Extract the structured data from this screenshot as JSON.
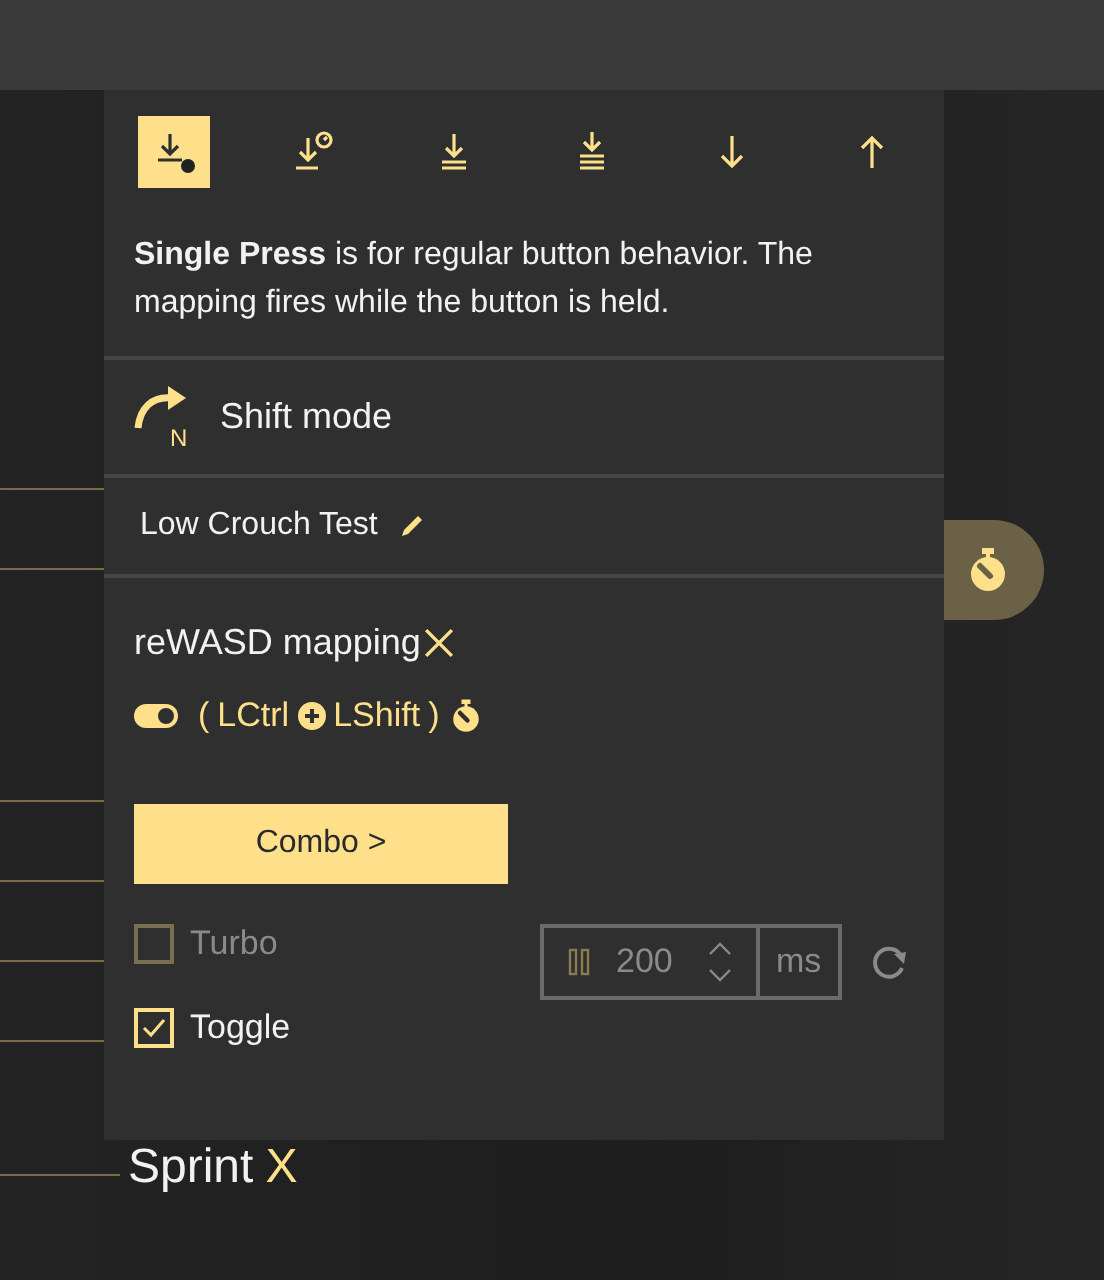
{
  "mode_tabs": [
    {
      "selected": true
    },
    {
      "selected": false
    },
    {
      "selected": false
    },
    {
      "selected": false
    },
    {
      "selected": false
    },
    {
      "selected": false
    }
  ],
  "description": "**Single Press** is for regular button behavior. The mapping fires while the button is held.",
  "shift_mode": {
    "label": "Shift mode",
    "badge": "N"
  },
  "mapping_name": "Low Crouch Test",
  "mapping": {
    "title": "reWASD mapping",
    "enabled": true,
    "open_paren": "(",
    "keys": [
      "LCtrl",
      "LShift"
    ],
    "close_paren": ")"
  },
  "combo_button": "Combo >",
  "options": [
    {
      "label": "Turbo",
      "checked": false,
      "disabled": true
    },
    {
      "label": "Toggle",
      "checked": true,
      "disabled": false
    }
  ],
  "turbo_delay": {
    "value": "200",
    "unit": "ms",
    "disabled": true
  },
  "background_label": {
    "text": "Sprint",
    "key": "X"
  }
}
